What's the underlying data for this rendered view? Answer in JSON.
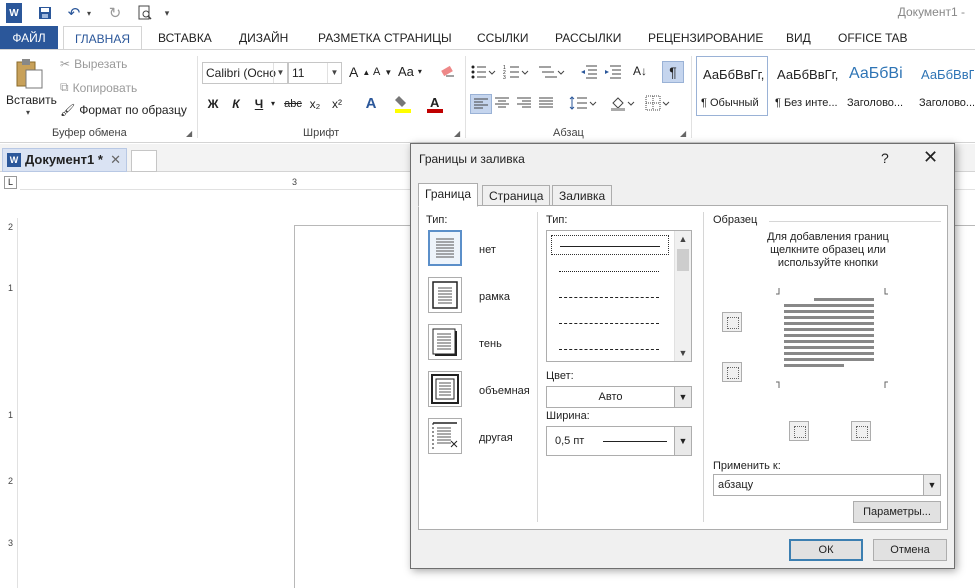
{
  "window": {
    "title": "Документ1 -"
  },
  "qat": {
    "icons": [
      "word-logo-icon",
      "save-icon",
      "undo-icon",
      "redo-icon",
      "print-preview-icon",
      "customize-qat-icon"
    ]
  },
  "tabs": [
    {
      "label": "ФАЙЛ"
    },
    {
      "label": "ГЛАВНАЯ"
    },
    {
      "label": "ВСТАВКА"
    },
    {
      "label": "ДИЗАЙН"
    },
    {
      "label": "РАЗМЕТКА СТРАНИЦЫ"
    },
    {
      "label": "ССЫЛКИ"
    },
    {
      "label": "РАССЫЛКИ"
    },
    {
      "label": "РЕЦЕНЗИРОВАНИЕ"
    },
    {
      "label": "ВИД"
    },
    {
      "label": "OFFICE TAB"
    }
  ],
  "clipboard": {
    "paste": "Вставить",
    "cut": "Вырезать",
    "copy": "Копировать",
    "format_painter": "Формат по образцу",
    "group": "Буфер обмена"
  },
  "font": {
    "family": "Calibri (Осно",
    "size": "11",
    "bold": "Ж",
    "italic": "К",
    "underline": "Ч",
    "strike": "abc",
    "subscript": "x₂",
    "superscript": "x²",
    "grow": "A",
    "shrink": "A",
    "case": "Aa",
    "group": "Шрифт"
  },
  "paragraph": {
    "group": "Абзац",
    "show_marks": "¶"
  },
  "styles": [
    {
      "sample": "АаБбВвГг,",
      "name": "¶ Обычный"
    },
    {
      "sample": "АаБбВвГг,",
      "name": "¶ Без инте..."
    },
    {
      "sample": "АаБбВі",
      "name": "Заголово..."
    },
    {
      "sample": "АаБбВвГ",
      "name": "Заголово..."
    }
  ],
  "document": {
    "tab_name": "Документ1 *",
    "close": "✕",
    "ruler_corner": "L",
    "ruler_top": "3",
    "ruler_left": [
      "2",
      "1",
      "1",
      "2",
      "3"
    ]
  },
  "dialog": {
    "title": "Границы и заливка",
    "help": "?",
    "close": "✕",
    "tabs": [
      "Граница",
      "Страница",
      "Заливка"
    ],
    "setting_label": "Тип:",
    "settings": [
      "нет",
      "рамка",
      "тень",
      "объемная",
      "другая"
    ],
    "style_label": "Тип:",
    "color_label": "Цвет:",
    "color_value": "Авто",
    "width_label": "Ширина:",
    "width_value": "0,5 пт",
    "preview_label": "Образец",
    "preview_hint": [
      "Для добавления границ",
      "щелкните образец или",
      "используйте кнопки"
    ],
    "apply_label": "Применить к:",
    "apply_value": "абзацу",
    "options_button": "Параметры...",
    "ok_button": "ОК",
    "cancel_button": "Отмена"
  }
}
